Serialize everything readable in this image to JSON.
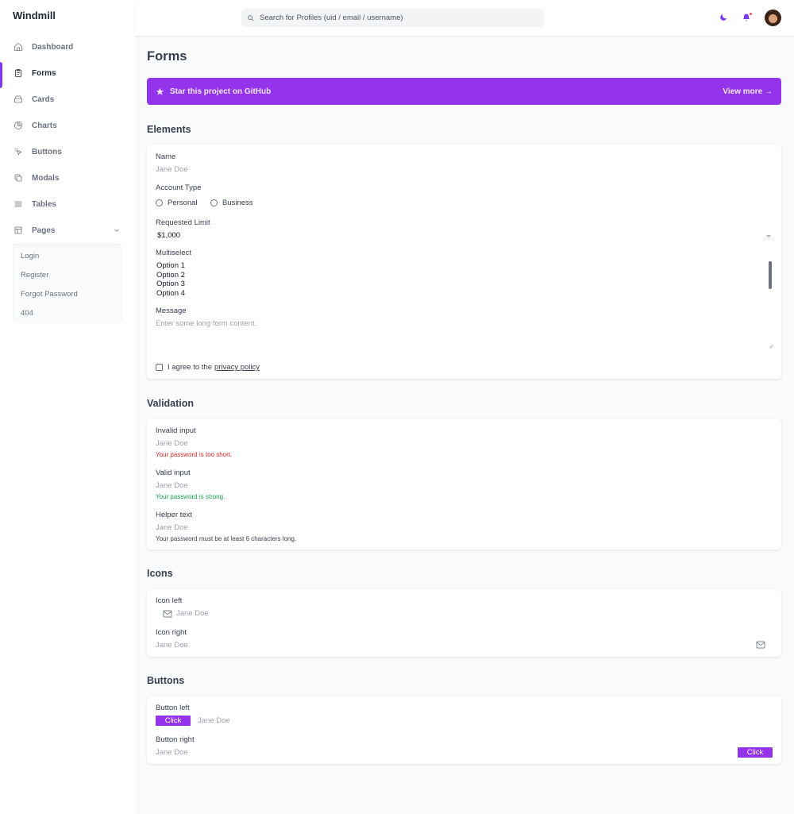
{
  "app": {
    "brand": "Windmill"
  },
  "sidebar": {
    "items": [
      {
        "label": "Dashboard",
        "icon": "home-icon"
      },
      {
        "label": "Forms",
        "icon": "forms-icon",
        "active": true
      },
      {
        "label": "Cards",
        "icon": "cards-icon"
      },
      {
        "label": "Charts",
        "icon": "chart-icon"
      },
      {
        "label": "Buttons",
        "icon": "cursor-icon"
      },
      {
        "label": "Modals",
        "icon": "modals-icon"
      },
      {
        "label": "Tables",
        "icon": "tables-icon"
      },
      {
        "label": "Pages",
        "icon": "pages-icon"
      }
    ],
    "submenu": [
      "Login",
      "Register",
      "Forgot Password",
      "404"
    ]
  },
  "header": {
    "search_placeholder": "Search for Profiles (uid / email / username)"
  },
  "page": {
    "title": "Forms",
    "banner": {
      "left": "Star this project on GitHub",
      "right": "View more →"
    }
  },
  "elements": {
    "title": "Elements",
    "name_label": "Name",
    "name_value": "Jane Doe",
    "account_type_label": "Account Type",
    "account_options": [
      "Personal",
      "Business"
    ],
    "limit_label": "Requested Limit",
    "limit_value": "$1,000",
    "multiselect_label": "Multiselect",
    "multiselect_options": [
      "Option 1",
      "Option 2",
      "Option 3",
      "Option 4"
    ],
    "message_label": "Message",
    "message_placeholder": "Enter some long form content.",
    "agree_text": "I agree to the",
    "agree_link": "privacy policy"
  },
  "validation": {
    "title": "Validation",
    "invalid_label": "Invalid input",
    "invalid_value": "Jane Doe",
    "invalid_help": "Your password is too short.",
    "valid_label": "Valid input",
    "valid_value": "Jane Doe",
    "valid_help": "Your password is strong.",
    "helper_label": "Helper text",
    "helper_value": "Jane Doe",
    "helper_help": "Your password must be at least 6 characters long."
  },
  "icons": {
    "title": "Icons",
    "left_label": "Icon left",
    "left_value": "Jane Doe",
    "right_label": "Icon right",
    "right_value": "Jane Doe"
  },
  "buttons": {
    "title": "Buttons",
    "left_label": "Button left",
    "left_button": "Click",
    "left_value": "Jane Doe",
    "right_label": "Button right",
    "right_value": "Jane Doe",
    "right_button": "Click"
  },
  "colors": {
    "accent": "#9333ea",
    "error": "#dc2626",
    "success": "#16a34a"
  }
}
